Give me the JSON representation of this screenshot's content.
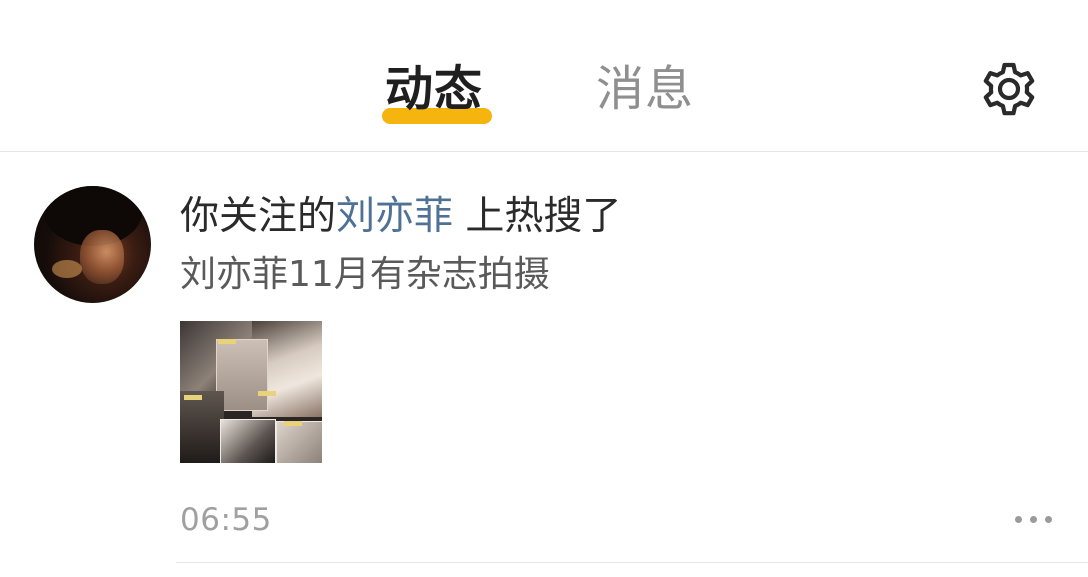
{
  "header": {
    "tabs": [
      {
        "label": "动态",
        "active": true
      },
      {
        "label": "消息",
        "active": false
      }
    ],
    "settings_icon": "gear-icon",
    "accent_color": "#f6b40e"
  },
  "feed": {
    "items": [
      {
        "avatar": "celebrity-avatar",
        "headline_prefix": "你关注的",
        "headline_name": "刘亦菲",
        "headline_suffix": " 上热搜了",
        "subline": "刘亦菲11月有杂志拍摄",
        "thumbnail": "magazine-collage-image",
        "time": "06:55",
        "more_icon": "more-dots-icon"
      }
    ]
  },
  "colors": {
    "name_link": "#4f7196",
    "primary_text": "#2a2a2a",
    "secondary_text": "#5a5a5a",
    "muted_text": "#a0a0a0"
  }
}
